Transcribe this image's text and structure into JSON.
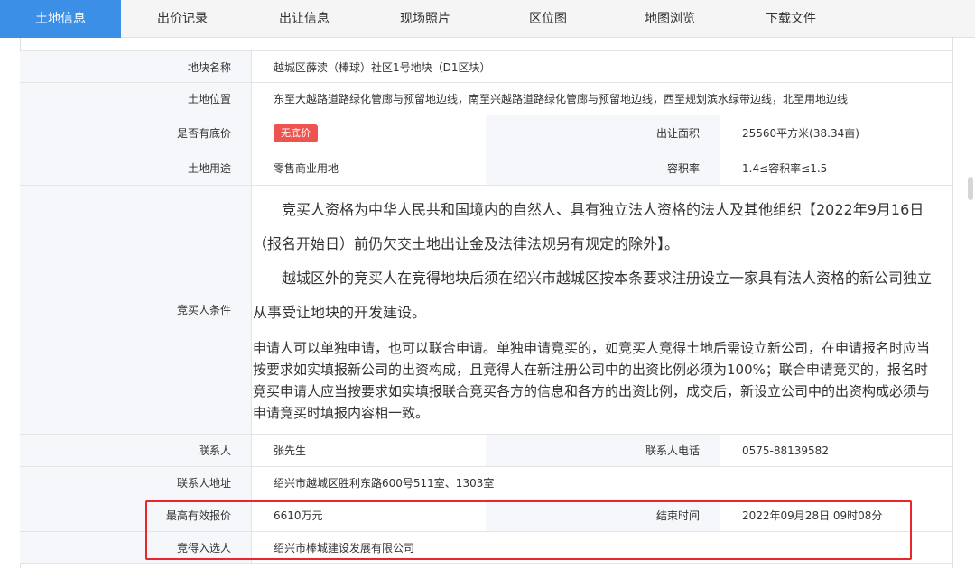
{
  "tabs": [
    {
      "label": "土地信息"
    },
    {
      "label": "出价记录"
    },
    {
      "label": "出让信息"
    },
    {
      "label": "现场照片"
    },
    {
      "label": "区位图"
    },
    {
      "label": "地图浏览"
    },
    {
      "label": "下载文件"
    }
  ],
  "info": {
    "parcel_name_label": "地块名称",
    "parcel_name": "越城区薛渎（棒球）社区1号地块（D1区块）",
    "location_label": "土地位置",
    "location": "东至大越路道路绿化管廊与预留地边线，南至兴越路道路绿化管廊与预留地边线，西至规划滨水绿带边线，北至用地边线",
    "reserve_label": "是否有底价",
    "reserve_badge": "无底价",
    "area_label": "出让面积",
    "area": "25560平方米(38.34亩)",
    "use_label": "土地用途",
    "use": "零售商业用地",
    "far_label": "容积率",
    "far": "1.4≤容积率≤1.5",
    "conditions_label": "竞买人条件",
    "conditions_p1": "竞买人资格为中华人民共和国境内的自然人、具有独立法人资格的法人及其他组织【2022年9月16日（报名开始日）前仍欠交土地出让金及法律法规另有规定的除外】。",
    "conditions_p2": "越城区外的竞买人在竞得地块后须在绍兴市越城区按本条要求注册设立一家具有法人资格的新公司独立从事受让地块的开发建设。",
    "conditions_p3": "申请人可以单独申请，也可以联合申请。单独申请竞买的，如竞买人竞得土地后需设立新公司，在申请报名时应当按要求如实填报新公司的出资构成，且竞得人在新注册公司中的出资比例必须为100%；联合申请竞买的，报名时竞买申请人应当按要求如实填报联合竞买各方的信息和各方的出资比例，成交后，新设立公司中的出资构成必须与申请竞买时填报内容相一致。",
    "contact_label": "联系人",
    "contact": "张先生",
    "phone_label": "联系人电话",
    "phone": "0575-88139582",
    "address_label": "联系人地址",
    "address": "绍兴市越城区胜利东路600号511室、1303室",
    "max_bid_label": "最高有效报价",
    "max_bid": "6610万元",
    "end_time_label": "结束时间",
    "end_time": "2022年09月28日 09时08分",
    "winner_label": "竞得入选人",
    "winner": "绍兴市棒城建设发展有限公司"
  },
  "colors": {
    "active_tab": "#3b8fe6",
    "badge": "#ef5350",
    "highlight_border": "#e8262b",
    "label_bg": "#f5f7fa"
  }
}
